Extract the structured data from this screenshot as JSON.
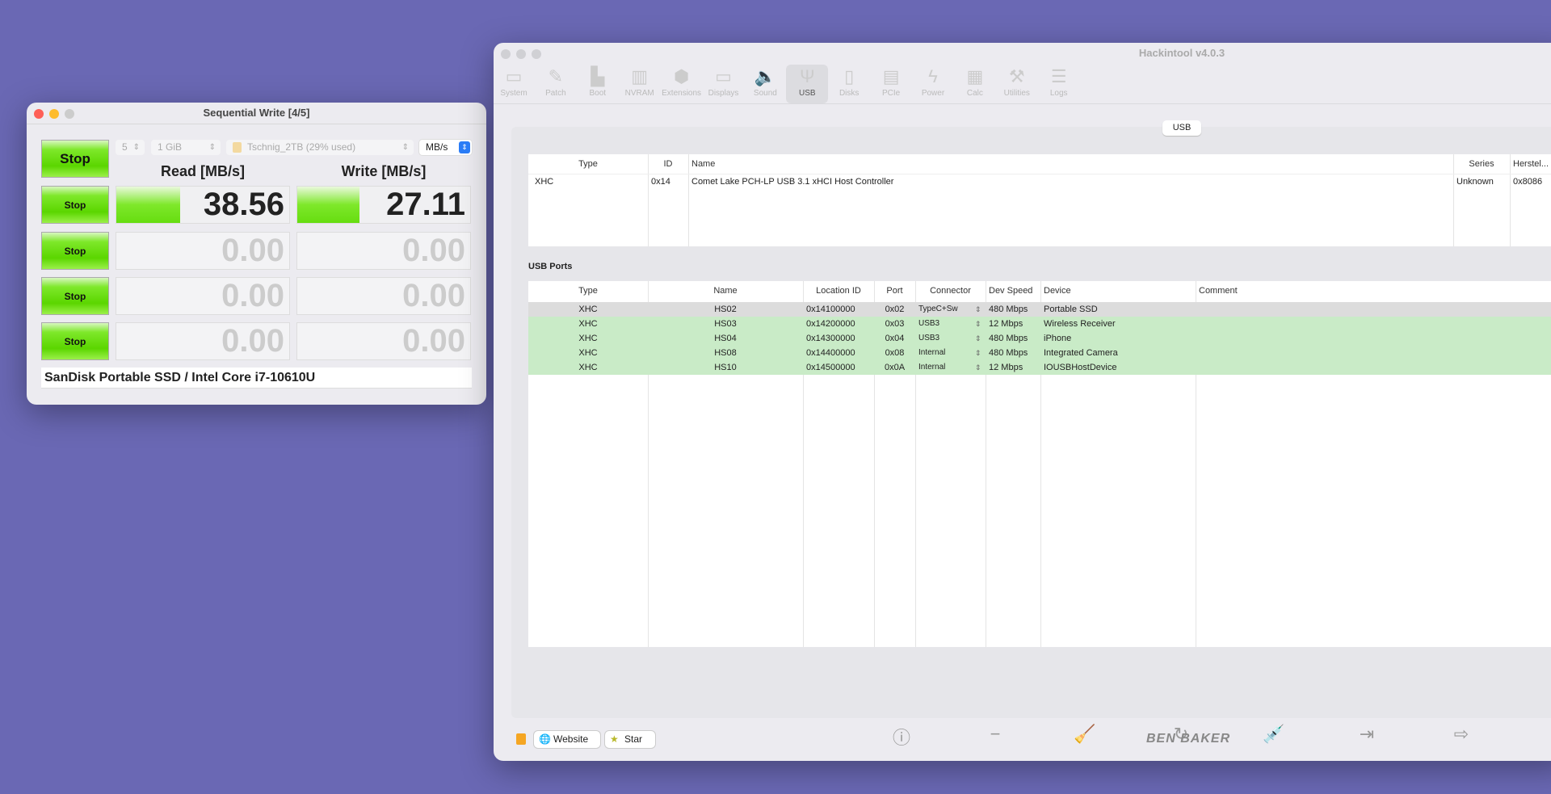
{
  "bench": {
    "title": "Sequential Write [4/5]",
    "count": "5",
    "size": "1 GiB",
    "drive": "Tschnig_2TB (29% used)",
    "unit": "MB/s",
    "read_header": "Read [MB/s]",
    "write_header": "Write [MB/s]",
    "stop_label": "Stop",
    "rows": [
      {
        "read": "38.56",
        "write": "27.11",
        "read_fill": 0.37,
        "write_fill": 0.36
      },
      {
        "read": "0.00",
        "write": "0.00"
      },
      {
        "read": "0.00",
        "write": "0.00"
      },
      {
        "read": "0.00",
        "write": "0.00"
      }
    ],
    "footer": "SanDisk Portable SSD / Intel Core i7-10610U"
  },
  "hack": {
    "title": "Hackintool v4.0.3",
    "toolbar": [
      {
        "label": "System",
        "icon": "▭"
      },
      {
        "label": "Patch",
        "icon": "✎"
      },
      {
        "label": "Boot",
        "icon": "▙"
      },
      {
        "label": "NVRAM",
        "icon": "▥"
      },
      {
        "label": "Extensions",
        "icon": "⬢"
      },
      {
        "label": "Displays",
        "icon": "▭"
      },
      {
        "label": "Sound",
        "icon": "🔈"
      },
      {
        "label": "USB",
        "icon": "Ψ"
      },
      {
        "label": "Disks",
        "icon": "▯"
      },
      {
        "label": "PCIe",
        "icon": "▤"
      },
      {
        "label": "Power",
        "icon": "ϟ"
      },
      {
        "label": "Calc",
        "icon": "▦"
      },
      {
        "label": "Utilities",
        "icon": "⚒"
      },
      {
        "label": "Logs",
        "icon": "☰"
      }
    ],
    "active_tab": "USB",
    "segment": "USB",
    "controllers": {
      "headers": [
        "Type",
        "ID",
        "Name",
        "Series",
        "Herstel..."
      ],
      "rows": [
        [
          "XHC",
          "0x14",
          "Comet Lake PCH-LP USB 3.1 xHCI Host Controller",
          "Unknown",
          "0x8086"
        ]
      ]
    },
    "ports_label": "USB Ports",
    "ports": {
      "headers": [
        "Type",
        "Name",
        "Location ID",
        "Port",
        "Connector",
        "Dev Speed",
        "Device",
        "Comment"
      ],
      "rows": [
        [
          "XHC",
          "HS02",
          "0x14100000",
          "0x02",
          "TypeC+Sw",
          "480 Mbps",
          "Portable SSD",
          ""
        ],
        [
          "XHC",
          "HS03",
          "0x14200000",
          "0x03",
          "USB3",
          "12 Mbps",
          "Wireless Receiver",
          ""
        ],
        [
          "XHC",
          "HS04",
          "0x14300000",
          "0x04",
          "USB3",
          "480 Mbps",
          "iPhone",
          ""
        ],
        [
          "XHC",
          "HS08",
          "0x14400000",
          "0x08",
          "Internal",
          "480 Mbps",
          "Integrated Camera",
          ""
        ],
        [
          "XHC",
          "HS10",
          "0x14500000",
          "0x0A",
          "Internal",
          "12 Mbps",
          "IOUSBHostDevice",
          ""
        ]
      ]
    },
    "website": "Website",
    "star": "Star",
    "brand": "BEN BAKER"
  },
  "colors": {
    "desktop": "#6a68b4",
    "green": "#5bd600",
    "row_green": "#c9ebc7"
  }
}
